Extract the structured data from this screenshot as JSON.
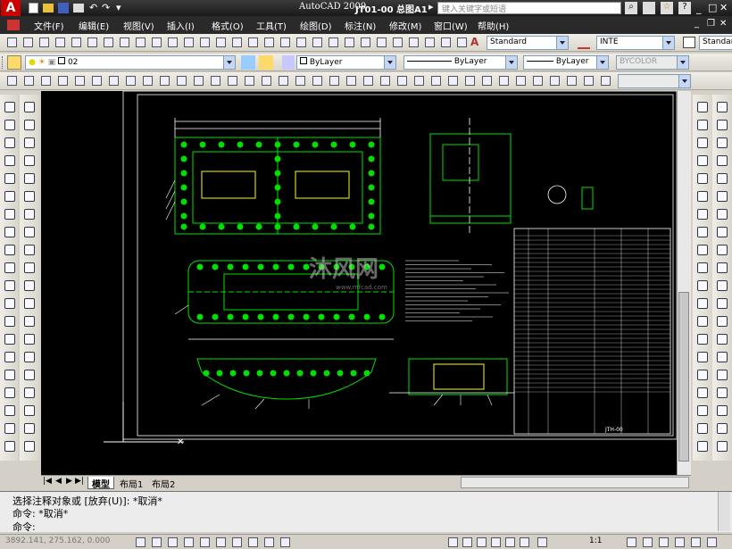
{
  "title": {
    "text": "AutoCAD 2009",
    "file": "JT01-00 总图A1",
    "search_placeholder": "键入关键字或短语"
  },
  "menu": [
    "文件(F)",
    "编辑(E)",
    "视图(V)",
    "插入(I)",
    "格式(O)",
    "工具(T)",
    "绘图(D)",
    "标注(N)",
    "修改(M)",
    "窗口(W)",
    "帮助(H)"
  ],
  "toolbar2": {
    "text_style": "Standard",
    "dim_style": "INTE",
    "table_style": "Standar"
  },
  "layer_toolbar": {
    "layer": "02",
    "color": "ByLayer",
    "linetype": "ByLayer",
    "lineweight": "ByLayer",
    "plotstyle": "BYCOLOR"
  },
  "tabs": [
    "模型",
    "布局1",
    "布局2"
  ],
  "command": {
    "line1": "选择注释对象或 [放弃(U)]: *取消*",
    "line2": "命令: *取消*",
    "line3": "命令:"
  },
  "status": {
    "coords": "3892.141, 275.162, 0.000",
    "scale": "1:1"
  },
  "drawing": {
    "title_tag": "JTH-00",
    "watermark": "沐风网",
    "watermark_url": "www.mfcad.com"
  },
  "colors": {
    "canvas": "#000000",
    "lines": "#00e000",
    "frame": "#ffffff"
  }
}
